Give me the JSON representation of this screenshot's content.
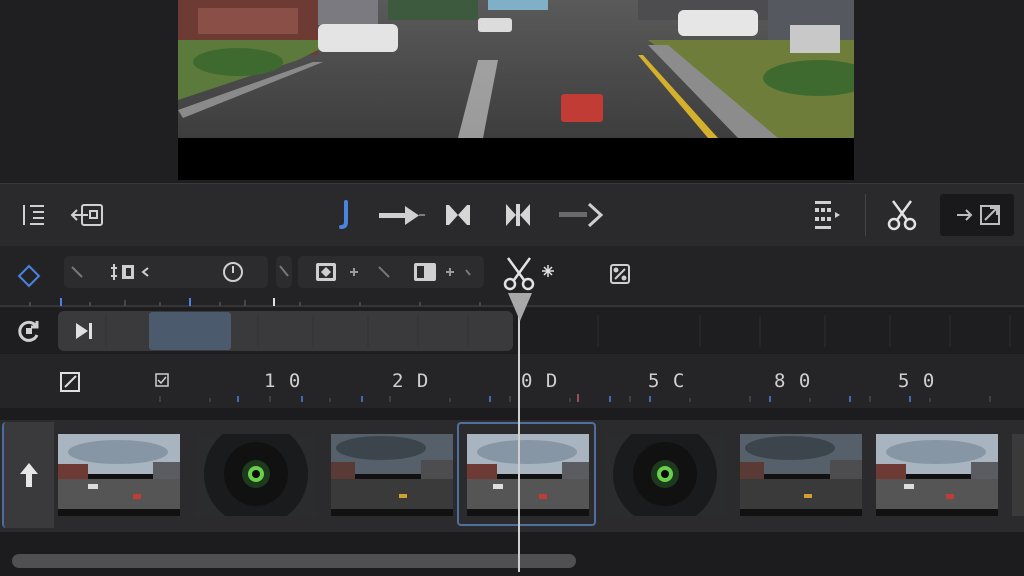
{
  "time_ruler": {
    "labels": [
      "1 0",
      "2 D",
      "0 D",
      "5 C",
      "8 0",
      "5 0"
    ]
  },
  "colors": {
    "accent": "#4a84e0",
    "panel": "#2a2a2c",
    "background": "#1c1c1e",
    "selection": "#4f6f9e"
  },
  "icons": {
    "toolbar": [
      "list-indent-icon",
      "import-icon",
      "blade-marker-icon",
      "forward-arrow-icon",
      "trim-start-icon",
      "trim-end-icon",
      "play-forward-icon",
      "fit-icon",
      "scissors-icon",
      "export-icon"
    ],
    "edit": [
      "keyframe-diamond-icon",
      "crop-icon",
      "speed-icon",
      "mask-icon",
      "overlay-icon",
      "split-scissors-icon",
      "transform-icon"
    ],
    "track": [
      "sync-icon",
      "play-end-icon",
      "edit-icon",
      "checkbox-icon",
      "up-arrow-icon"
    ]
  },
  "filmstrip": {
    "clips": [
      "street",
      "lens",
      "street-dark",
      "street",
      "lens",
      "street-dark",
      "street"
    ]
  }
}
